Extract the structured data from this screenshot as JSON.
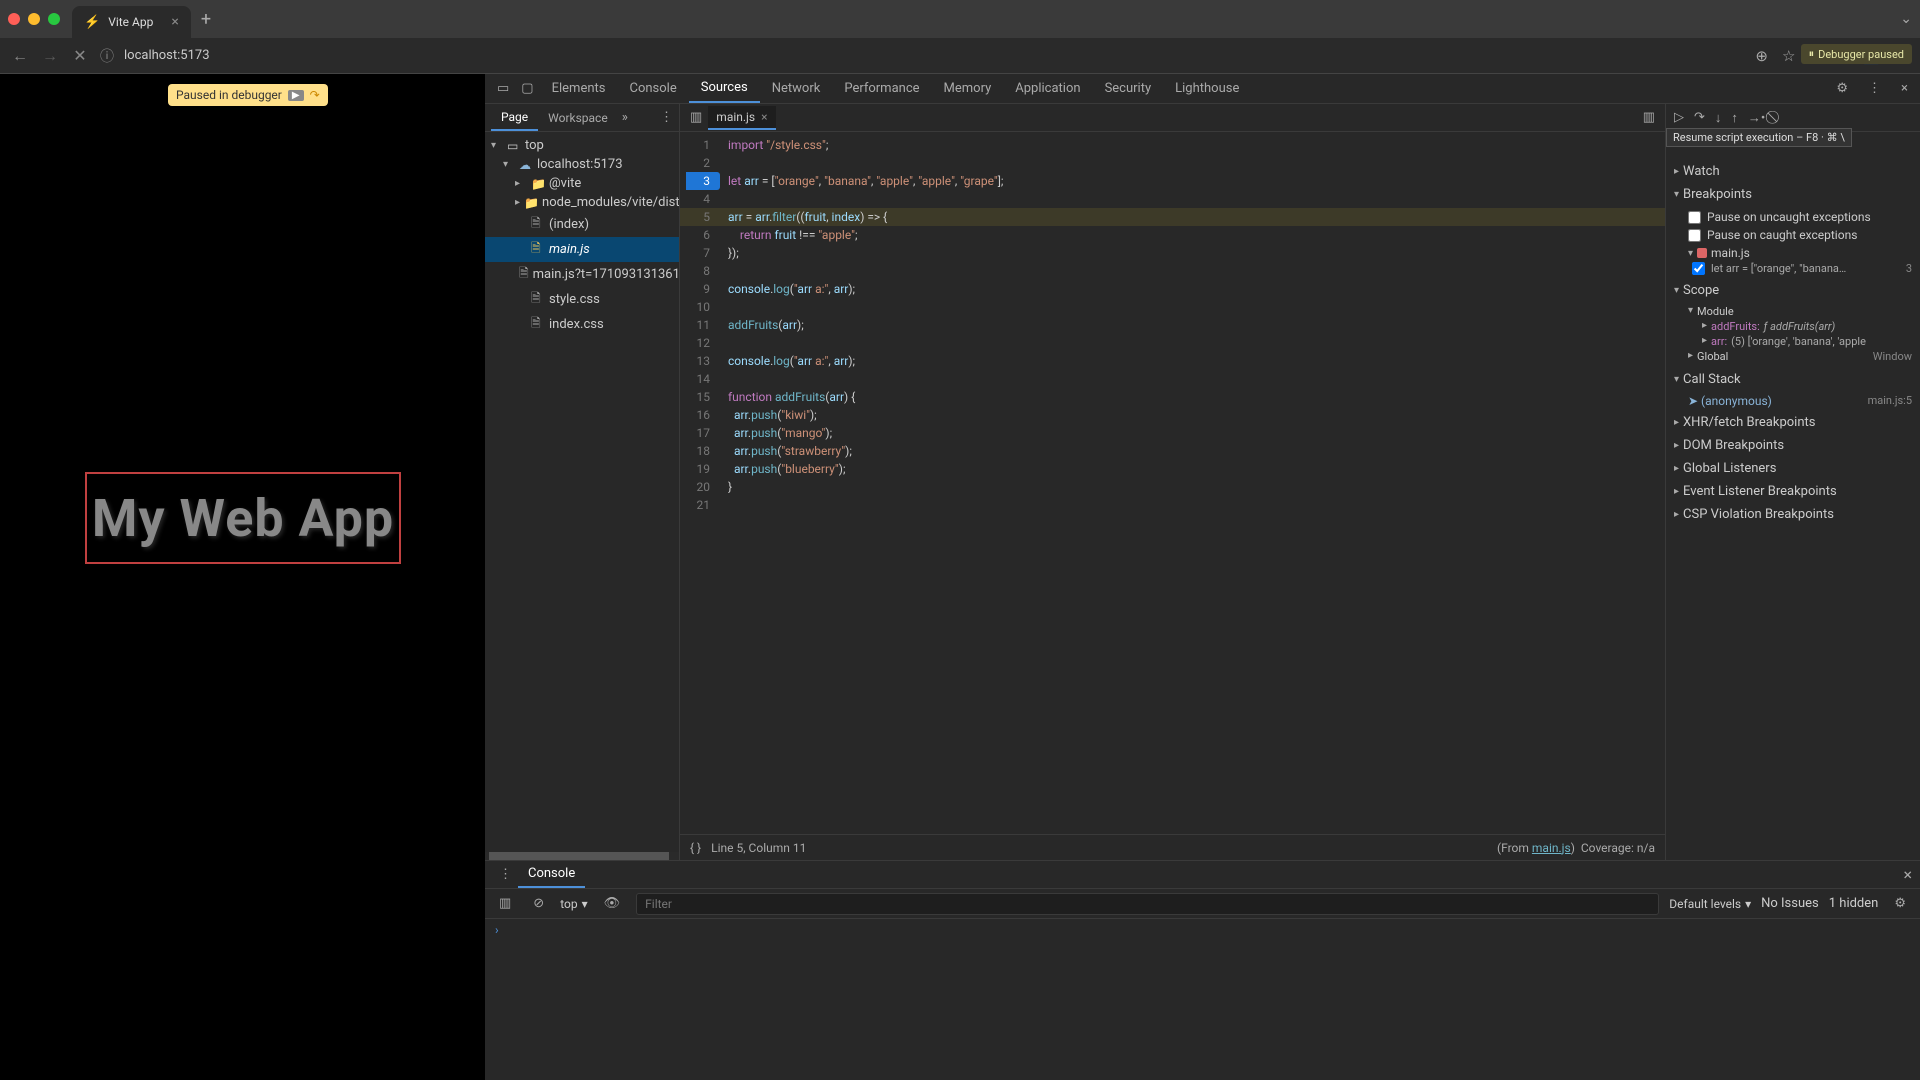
{
  "browser": {
    "tab_title": "Vite App",
    "url": "localhost:5173"
  },
  "page": {
    "paused_badge": "Paused in debugger",
    "heading": "My Web App"
  },
  "devtools": {
    "tabs": [
      "Elements",
      "Console",
      "Sources",
      "Network",
      "Performance",
      "Memory",
      "Application",
      "Security",
      "Lighthouse"
    ],
    "active_tab": "Sources"
  },
  "sources_nav": {
    "tabs": [
      "Page",
      "Workspace"
    ],
    "tree": {
      "top": "top",
      "host": "localhost:5173",
      "vite": "@vite",
      "node_mod": "node_modules/vite/dist/c",
      "index": "(index)",
      "mainjs": "main.js",
      "mainjs_ts": "main.js?t=171093131361",
      "stylecss": "style.css",
      "indexcss": "index.css"
    }
  },
  "editor": {
    "filename": "main.js",
    "lines": [
      {
        "n": 1,
        "code": "import \"/style.css\";"
      },
      {
        "n": 2,
        "code": ""
      },
      {
        "n": 3,
        "code": "let arr = [\"orange\", \"banana\", \"apple\", \"apple\", \"grape\"];",
        "bp": true
      },
      {
        "n": 4,
        "code": ""
      },
      {
        "n": 5,
        "code": "arr = arr.filter((fruit, index) => {",
        "exec": true
      },
      {
        "n": 6,
        "code": "    return fruit !== \"apple\";"
      },
      {
        "n": 7,
        "code": "});"
      },
      {
        "n": 8,
        "code": ""
      },
      {
        "n": 9,
        "code": "console.log(\"arr a:\", arr);"
      },
      {
        "n": 10,
        "code": ""
      },
      {
        "n": 11,
        "code": "addFruits(arr);"
      },
      {
        "n": 12,
        "code": ""
      },
      {
        "n": 13,
        "code": "console.log(\"arr a:\", arr);"
      },
      {
        "n": 14,
        "code": ""
      },
      {
        "n": 15,
        "code": "function addFruits(arr) {"
      },
      {
        "n": 16,
        "code": "  arr.push(\"kiwi\");"
      },
      {
        "n": 17,
        "code": "  arr.push(\"mango\");"
      },
      {
        "n": 18,
        "code": "  arr.push(\"strawberry\");"
      },
      {
        "n": 19,
        "code": "  arr.push(\"blueberry\");"
      },
      {
        "n": 20,
        "code": "}"
      },
      {
        "n": 21,
        "code": ""
      }
    ],
    "status_cursor": "Line 5, Column 11",
    "status_from": "(From ",
    "status_from_link": "main.js",
    "status_from_suffix": ")",
    "status_coverage": "Coverage: n/a"
  },
  "debugger": {
    "tooltip": "Resume script execution – F8 · ⌘ \\",
    "paused_label": "Debugger paused",
    "watch": "Watch",
    "breakpoints": "Breakpoints",
    "bp_uncaught": "Pause on uncaught exceptions",
    "bp_caught": "Pause on caught exceptions",
    "bp_file": "main.js",
    "bp_entry": "let arr = [\"orange\", \"banana…",
    "bp_entry_line": "3",
    "scope": "Scope",
    "scope_module": "Module",
    "scope_addFruits_k": "addFruits:",
    "scope_addFruits_v": "ƒ addFruits(arr)",
    "scope_arr_k": "arr:",
    "scope_arr_v": "(5) ['orange', 'banana', 'apple",
    "scope_global": "Global",
    "scope_global_v": "Window",
    "callstack": "Call Stack",
    "cs_frame": "(anonymous)",
    "cs_loc": "main.js:5",
    "xhr_bp": "XHR/fetch Breakpoints",
    "dom_bp": "DOM Breakpoints",
    "global_listeners": "Global Listeners",
    "ev_bp": "Event Listener Breakpoints",
    "csp_bp": "CSP Violation Breakpoints"
  },
  "console": {
    "tab": "Console",
    "context": "top",
    "filter_placeholder": "Filter",
    "levels": "Default levels",
    "issues": "No Issues",
    "hidden": "1 hidden"
  }
}
